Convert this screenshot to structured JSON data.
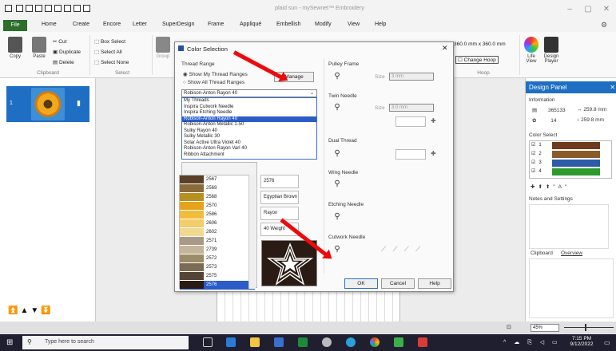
{
  "window": {
    "title": "plaid sun - mySewnet™ Embroidery",
    "minimize": "–",
    "restore": "▢",
    "close": "✕"
  },
  "menu": {
    "file": "File",
    "items": [
      "Home",
      "Create",
      "Encore",
      "Letter",
      "SuperDesign",
      "Frame",
      "Appliqué",
      "Embellish",
      "Modify",
      "View",
      "Help"
    ]
  },
  "ribbon": {
    "copy": "Copy",
    "paste": "Paste",
    "cut": "Cut",
    "duplicate": "Duplicate",
    "delete": "Delete",
    "clipboard_group": "Clipboard",
    "box_select": "Box Select",
    "select_all": "Select All",
    "select_none": "Select None",
    "select_group": "Select",
    "group": "Group",
    "hoop_size": "360.0 mm x 360.0 mm",
    "change_hoop": "Change Hoop",
    "hoop_group": "Hoop",
    "life_view": "Life View",
    "design_player": "Design Player"
  },
  "left_panel": {
    "design_number": "1"
  },
  "dialog": {
    "title": "Color Selection",
    "close": "✕",
    "thread_range_label": "Thread Range",
    "show_my_threads": "Show My Thread Ranges",
    "show_all_threads": "Show All Thread Ranges",
    "manage_button": "Manage",
    "selected_range": "Robison-Anton Rayon 40",
    "range_options": [
      "My Threads",
      "Inspira Cutwork Needle",
      "Inspira Etching Needle",
      "Robison-Anton Rayon 40",
      "Robison-Anton Metallic 1-50",
      "Sulky Rayon 40",
      "Sulky Metallic 30",
      "Solar Active Ultra Violet 40",
      "Robison-Anton Rayon Varl 40",
      "Ribbon Attachment"
    ],
    "selected_option_index": 3,
    "thread_codes": [
      {
        "code": "2567",
        "color": "#5a4028"
      },
      {
        "code": "2569",
        "color": "#8a6a3a"
      },
      {
        "code": "2568",
        "color": "#b8901f"
      },
      {
        "code": "2570",
        "color": "#e6a21c"
      },
      {
        "code": "2586",
        "color": "#f0bc3a"
      },
      {
        "code": "2606",
        "color": "#f3cd6a"
      },
      {
        "code": "2602",
        "color": "#f2d890"
      },
      {
        "code": "2571",
        "color": "#a89a86"
      },
      {
        "code": "2739",
        "color": "#c4b49a"
      },
      {
        "code": "2572",
        "color": "#9a8c66"
      },
      {
        "code": "2573",
        "color": "#7a6c52"
      },
      {
        "code": "2575",
        "color": "#544636"
      },
      {
        "code": "2576",
        "color": "#2a1c14"
      }
    ],
    "selected_code_index": 12,
    "current_code": "2576",
    "current_name": "Egyptian Brown",
    "current_type": "Rayon",
    "current_weight": "40 Weight",
    "pulley_frame_label": "Pulley Frame",
    "size_label": "Size",
    "pulley_size_value": "3 mm",
    "twin_needle_label": "Twin Needle",
    "twin_size_value": "3.0 mm",
    "dual_thread_label": "Dual Thread",
    "wing_needle_label": "Wing Needle",
    "etching_needle_label": "Etching Needle",
    "cutwork_needle_label": "Cutwork Needle",
    "ok_button": "OK",
    "cancel_button": "Cancel",
    "help_button": "Help"
  },
  "design_panel": {
    "title": "Design Panel",
    "information_label": "Information",
    "stitches": "365133",
    "width": "259.8 mm",
    "colors": "14",
    "height": "259.8 mm",
    "color_select_label": "Color Select",
    "color_rows": [
      {
        "num": "1",
        "color": "#6e3b1e"
      },
      {
        "num": "2",
        "color": "#8a5a2a"
      },
      {
        "num": "3",
        "color": "#2a5ca8"
      },
      {
        "num": "4",
        "color": "#2e9a2e"
      }
    ],
    "all_label": "\"A\"",
    "notes_label": "Notes and Settings",
    "clipboard_tab": "Clipboard",
    "overview_tab": "Overview"
  },
  "status": {
    "zoom": "45%"
  },
  "taskbar": {
    "search_placeholder": "Type here to search",
    "time": "7:15 PM",
    "date": "9/12/2022"
  },
  "colors": {
    "accent_blue": "#1e6fc4",
    "file_green": "#2b6f2b",
    "arrow_red": "#ee0a0a"
  }
}
